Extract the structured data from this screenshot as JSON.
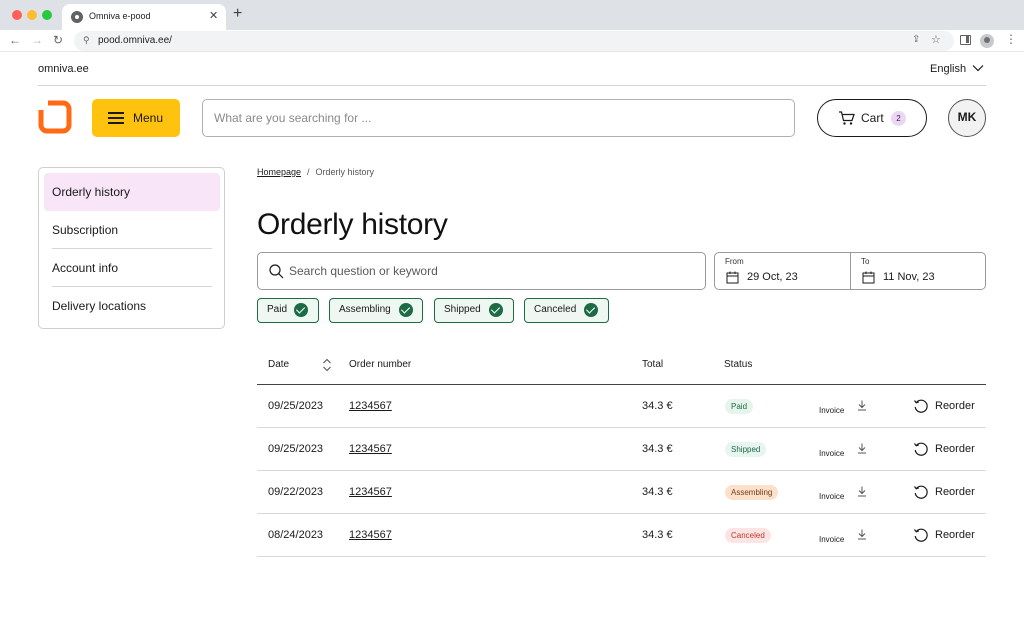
{
  "browser": {
    "tab_title": "Omniva e-pood",
    "url": "pood.omniva.ee/"
  },
  "site": {
    "domain": "omniva.ee",
    "language": "English",
    "brand_color": "#ff6a13",
    "menu_color": "#ffc20e"
  },
  "header": {
    "menu_label": "Menu",
    "search_placeholder": "What are you searching for ...",
    "cart_label": "Cart",
    "cart_count": "2",
    "avatar_initials": "MK"
  },
  "sidebar": {
    "items": [
      {
        "label": "Orderly history",
        "active": true
      },
      {
        "label": "Subscription"
      },
      {
        "label": "Account info"
      },
      {
        "label": "Delivery locations"
      }
    ]
  },
  "breadcrumb": {
    "home": "Homepage",
    "separator": "/",
    "current": "Orderly history"
  },
  "page": {
    "title": "Orderly history",
    "search_placeholder": "Search question or keyword"
  },
  "date_range": {
    "from_label": "From",
    "from_value": "29 Oct, 23",
    "to_label": "To",
    "to_value": "11 Nov, 23"
  },
  "filters": [
    {
      "label": "Paid",
      "checked": true
    },
    {
      "label": "Assembling",
      "checked": true
    },
    {
      "label": "Shipped",
      "checked": true
    },
    {
      "label": "Canceled",
      "checked": true
    }
  ],
  "table": {
    "headers": {
      "date": "Date",
      "order_number": "Order number",
      "total": "Total",
      "status": "Status"
    },
    "rows": [
      {
        "date": "09/25/2023",
        "order": "1234567",
        "total": "34.3 €",
        "status": "Paid",
        "invoice": "Invoice",
        "reorder": "Reorder"
      },
      {
        "date": "09/25/2023",
        "order": "1234567",
        "total": "34.3 €",
        "status": "Shipped",
        "invoice": "Invoice",
        "reorder": "Reorder"
      },
      {
        "date": "09/22/2023",
        "order": "1234567",
        "total": "34.3 €",
        "status": "Assembling",
        "invoice": "Invoice",
        "reorder": "Reorder"
      },
      {
        "date": "08/24/2023",
        "order": "1234567",
        "total": "34.3 €",
        "status": "Canceled",
        "invoice": "Invoice",
        "reorder": "Reorder"
      }
    ]
  }
}
